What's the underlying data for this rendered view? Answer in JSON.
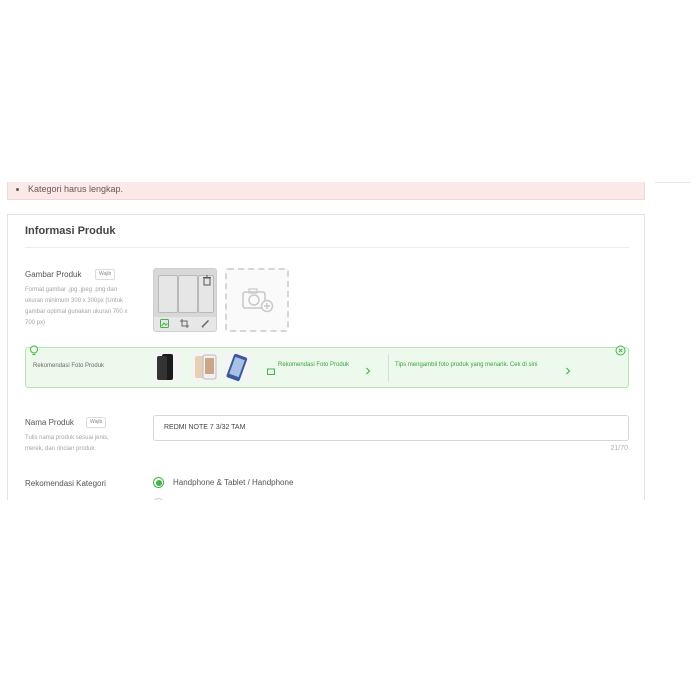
{
  "errors": [
    "Kategori harus lengkap."
  ],
  "card": {
    "title": "Informasi Produk",
    "image_section": {
      "label": "Gambar Produk",
      "badge": "Wajib",
      "help": "Format gambar .jpg .jpeg .png dan ukuran minimum 300 x 300px (Untuk gambar optimal gunakan ukuran 700 x 700 px)"
    },
    "photo_recommendation": {
      "label": "Rekomendasi Foto Produk",
      "link_label": "Rekomendasi Foto Produk",
      "tips_label": "Tips mengambil foto produk yang menarik. Cek di sini"
    },
    "name_section": {
      "label": "Nama Produk",
      "badge": "Wajib",
      "help": "Tulis nama produk sesuai jenis, merek, dan rincian produk.",
      "value": "REDMI NOTE 7 3/32 TAM",
      "counter": "21/70"
    },
    "category_section": {
      "label": "Rekomendasi Kategori",
      "options": [
        "Handphone & Tablet / Handphone"
      ]
    }
  },
  "colors": {
    "accent": "#42b549",
    "error_bg": "#fbe9ea",
    "reco_bg": "#edf9ec"
  }
}
